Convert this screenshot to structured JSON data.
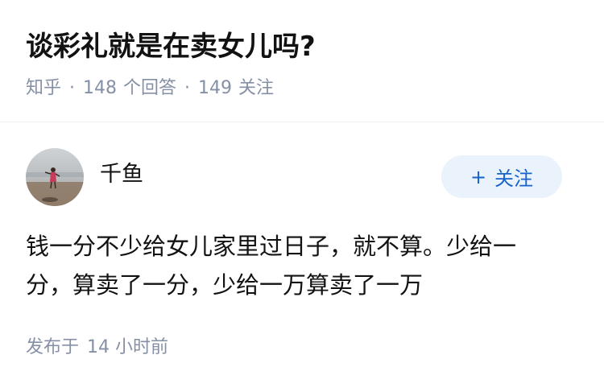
{
  "question": {
    "title": "谈彩礼就是在卖女儿吗?",
    "source": "知乎",
    "separator": "·",
    "answer_count": "148",
    "answer_label": "个回答",
    "follower_count": "149",
    "follower_label": "关注"
  },
  "answer": {
    "author": {
      "name": "千鱼",
      "avatar": "avatar-photo"
    },
    "follow_button": {
      "icon": "+",
      "label": "关注"
    },
    "content": "钱一分不少给女儿家里过日子，就不算。少给一分，算卖了一分，少给一万算卖了一万",
    "published_prefix": "发布于",
    "published_time": "14 小时前"
  },
  "colors": {
    "title": "#121212",
    "meta": "#8590a6",
    "follow_bg": "#eaf2fc",
    "follow_text": "#1763c9",
    "divider": "#f0f0f0"
  }
}
